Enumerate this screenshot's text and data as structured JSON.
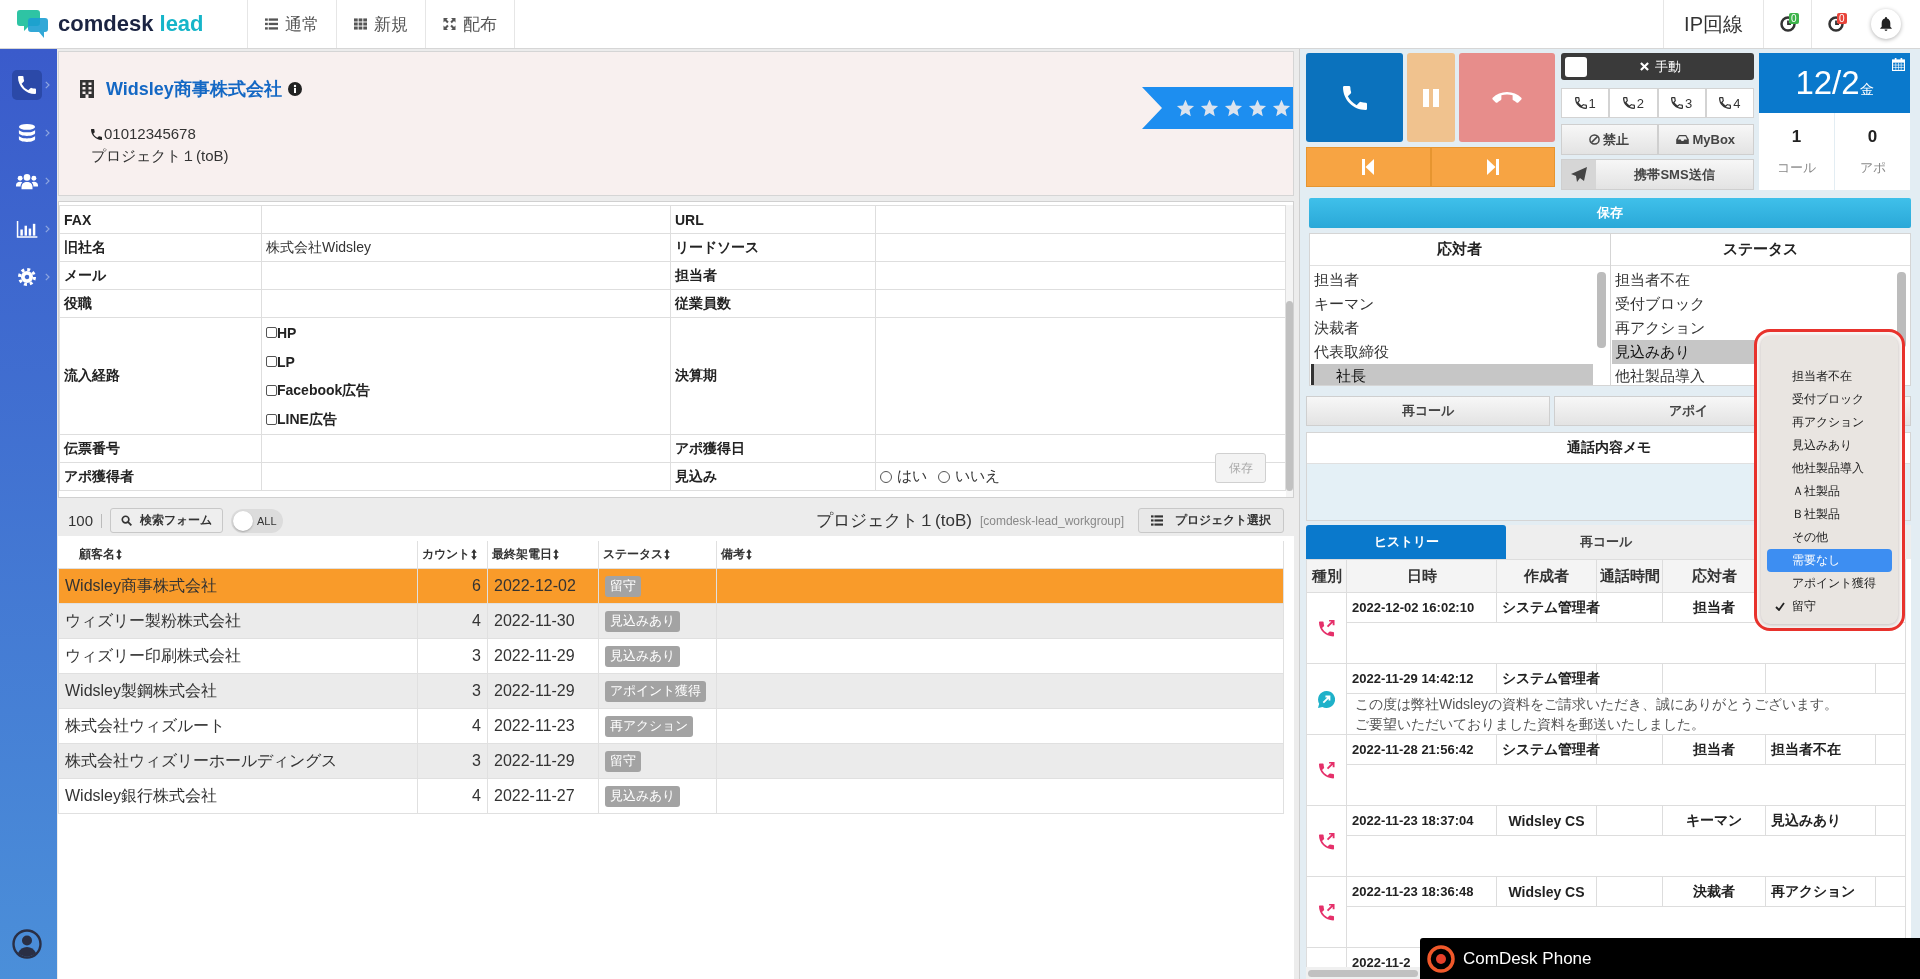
{
  "topbar": {
    "logo": {
      "brand": "comdesk",
      "product": "lead"
    },
    "nav": [
      {
        "label": "通常"
      },
      {
        "label": "新規"
      },
      {
        "label": "配布"
      }
    ],
    "line": "IP回線",
    "timers": [
      {
        "count": "0",
        "color": "#3db34a"
      },
      {
        "count": "0",
        "color": "#e8443a"
      }
    ]
  },
  "sidebar": {
    "items": [
      {
        "selected": true
      },
      {
        "selected": false
      },
      {
        "selected": false
      },
      {
        "selected": false
      },
      {
        "selected": false
      }
    ]
  },
  "header": {
    "company": "Widsley商事株式会社",
    "phone": "01012345678",
    "project": "プロジェクト１(toB)",
    "stars": 5
  },
  "form": {
    "rows": [
      {
        "left": {
          "label": "FAX",
          "kind": "text"
        },
        "right": {
          "label": "URL",
          "kind": "text"
        }
      },
      {
        "left": {
          "label": "旧社名",
          "kind": "text",
          "value": "株式会社Widsley"
        },
        "right": {
          "label": "リードソース",
          "kind": "text"
        }
      },
      {
        "left": {
          "label": "メール",
          "kind": "text"
        },
        "right": {
          "label": "担当者",
          "kind": "text"
        }
      },
      {
        "left": {
          "label": "役職",
          "kind": "text"
        },
        "right": {
          "label": "従業員数",
          "kind": "text"
        }
      },
      {
        "left": {
          "label": "流入経路",
          "kind": "checkboxes",
          "options": [
            {
              "label": "HP",
              "checked": false
            },
            {
              "label": "LP",
              "checked": false
            },
            {
              "label": "Facebook広告",
              "checked": false
            },
            {
              "label": "LINE広告",
              "checked": false
            }
          ]
        },
        "right": {
          "label": "決算期",
          "kind": "text"
        }
      },
      {
        "left": {
          "label": "伝票番号",
          "kind": "text"
        },
        "right": {
          "label": "アポ獲得日",
          "kind": "text"
        }
      },
      {
        "left": {
          "label": "アポ獲得者",
          "kind": "text"
        },
        "right": {
          "label": "見込み",
          "kind": "radios",
          "options": [
            {
              "label": "はい",
              "selected": false
            },
            {
              "label": "いいえ",
              "selected": false
            }
          ]
        }
      }
    ],
    "save_button": {
      "label": "保存",
      "disabled": true
    }
  },
  "list_toolbar": {
    "page_size": "100",
    "search_button": "検索フォーム",
    "all_toggle": {
      "label": "ALL",
      "on": false
    },
    "project": "プロジェクト１(toB)",
    "workgroup": "[comdesk-lead_workgroup]",
    "project_button": "プロジェクト選択"
  },
  "customers": {
    "columns": [
      "顧客名",
      "カウント",
      "最終架電日",
      "ステータス",
      "備考"
    ],
    "rows": [
      {
        "name": "Widsley商事株式会社",
        "count": "6",
        "date": "2022-12-02",
        "status": "留守",
        "selected": true
      },
      {
        "name": "ウィズリー製粉株式会社",
        "count": "4",
        "date": "2022-11-30",
        "status": "見込みあり",
        "selected": false
      },
      {
        "name": "ウィズリー印刷株式会社",
        "count": "3",
        "date": "2022-11-29",
        "status": "見込みあり",
        "selected": false
      },
      {
        "name": "Widsley製鋼株式会社",
        "count": "3",
        "date": "2022-11-29",
        "status": "アポイント獲得",
        "selected": false
      },
      {
        "name": "株式会社ウィズルート",
        "count": "4",
        "date": "2022-11-23",
        "status": "再アクション",
        "selected": false
      },
      {
        "name": "株式会社ウィズリーホールディングス",
        "count": "3",
        "date": "2022-11-29",
        "status": "留守",
        "selected": false
      },
      {
        "name": "Widsley銀行株式会社",
        "count": "4",
        "date": "2022-11-27",
        "status": "見込みあり",
        "selected": false
      }
    ]
  },
  "call_panel": {
    "manual": "手動",
    "lines": [
      "1",
      "2",
      "3",
      "4"
    ],
    "block_button": "禁止",
    "mybox_button": "MyBox",
    "sms_button": "携帯SMS送信",
    "date": {
      "day": "12/2",
      "weekday": "金"
    },
    "stats": [
      {
        "value": "1",
        "label": "コール"
      },
      {
        "value": "0",
        "label": "アポ"
      }
    ],
    "save_button": "保存"
  },
  "responder": {
    "title": "応対者",
    "focused": true,
    "options": [
      {
        "label": "担当者",
        "selected": false
      },
      {
        "label": "キーマン",
        "selected": false
      },
      {
        "label": "決裁者",
        "selected": false
      },
      {
        "label": "代表取締役",
        "selected": false
      },
      {
        "label": "社長",
        "selected": true
      }
    ]
  },
  "status": {
    "title": "ステータス",
    "focused": false,
    "options": [
      {
        "label": "担当者不在",
        "selected": false
      },
      {
        "label": "受付ブロック",
        "selected": false
      },
      {
        "label": "再アクション",
        "selected": false
      },
      {
        "label": "見込みあり",
        "selected": true
      },
      {
        "label": "他社製品導入",
        "selected": false
      }
    ]
  },
  "actions": [
    "再コール",
    "アポイ"
  ],
  "memo": {
    "title": "通話内容メモ"
  },
  "history_tabs": [
    {
      "label": "ヒストリー",
      "selected": true
    },
    {
      "label": "再コール",
      "selected": false
    }
  ],
  "history": {
    "columns": [
      "種別",
      "日時",
      "作成者",
      "通話時間",
      "応対者"
    ],
    "rows": [
      {
        "kind": "call",
        "datetime": "2022-12-02 16:02:10",
        "creator": "システム管理者",
        "responder": "担当者"
      },
      {
        "kind": "message",
        "datetime": "2022-11-29 14:42:12",
        "creator": "システム管理者",
        "memo": [
          "この度は弊社Widsleyの資料をご請求いただき、誠にありがとうございます。",
          "ご要望いただいておりました資料を郵送いたしました。"
        ]
      },
      {
        "kind": "call",
        "datetime": "2022-11-28 21:56:42",
        "creator": "システム管理者",
        "responder": "担当者",
        "status": "担当者不在"
      },
      {
        "kind": "call",
        "datetime": "2022-11-23 18:37:04",
        "creator": "Widsley CS",
        "responder": "キーマン",
        "status": "見込みあり"
      },
      {
        "kind": "call",
        "datetime": "2022-11-23 18:36:48",
        "creator": "Widsley CS",
        "responder": "決裁者",
        "status": "再アクション"
      },
      {
        "datetime": "2022-11-2"
      }
    ]
  },
  "status_dropdown": {
    "options": [
      {
        "label": "担当者不在",
        "highlighted": false,
        "checked": false
      },
      {
        "label": "受付ブロック",
        "highlighted": false,
        "checked": false
      },
      {
        "label": "再アクション",
        "highlighted": false,
        "checked": false
      },
      {
        "label": "見込みあり",
        "highlighted": false,
        "checked": false
      },
      {
        "label": "他社製品導入",
        "highlighted": false,
        "checked": false
      },
      {
        "label": "Ａ社製品",
        "highlighted": false,
        "checked": false
      },
      {
        "label": "Ｂ社製品",
        "highlighted": false,
        "checked": false
      },
      {
        "label": "その他",
        "highlighted": false,
        "checked": false
      },
      {
        "label": "需要なし",
        "highlighted": true,
        "checked": false
      },
      {
        "label": "アポイント獲得",
        "highlighted": false,
        "checked": false
      },
      {
        "label": "留守",
        "highlighted": false,
        "checked": true
      }
    ]
  },
  "phone_widget": {
    "title": "ComDesk Phone"
  }
}
